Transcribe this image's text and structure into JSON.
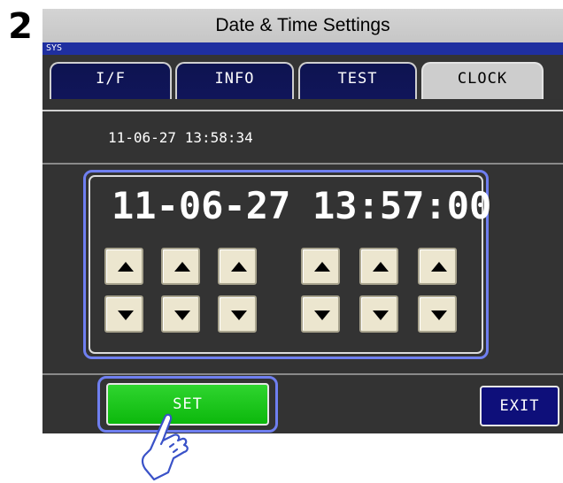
{
  "step": {
    "number": "2"
  },
  "title": "Date & Time Settings",
  "status_bar": {
    "label": "SYS"
  },
  "tabs": [
    {
      "label": "I/F",
      "active": false
    },
    {
      "label": "INFO",
      "active": false
    },
    {
      "label": "TEST",
      "active": false
    },
    {
      "label": "CLOCK",
      "active": true
    }
  ],
  "current_time": "11-06-27 13:58:34",
  "editor": {
    "date": "11-06-27",
    "time": "13:57:00",
    "buttons": {
      "up": "up-arrow-icon",
      "down": "down-arrow-icon"
    }
  },
  "set_button": {
    "label": "SET"
  },
  "exit_button": {
    "label": "EXIT"
  },
  "colors": {
    "screen_bg": "#333333",
    "status_bar": "#1f2fa0",
    "tab_inactive": "#10155a",
    "tab_active": "#cdcdcd",
    "highlight_frame": "#6f7ff0",
    "arrow_button": "#ece6cf",
    "set_button": "#0cb80c",
    "exit_button": "#0e0f7a"
  },
  "icons": {
    "hand": "pointing-hand-icon"
  }
}
